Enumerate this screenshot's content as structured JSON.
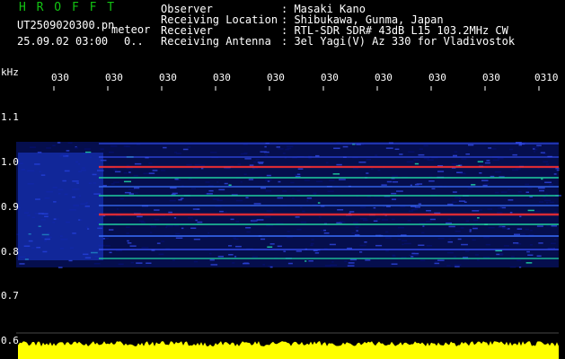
{
  "title": "H R O F F T",
  "file_name": "UT2509020300.pn",
  "meteor_label": "meteor",
  "date_time": "25.09.02 03:00",
  "count": "0..",
  "header": {
    "rows": [
      {
        "label": "Observer",
        "value": ": Masaki Kano"
      },
      {
        "label": "Receiving Location",
        "value": ": Shibukawa, Gunma, Japan"
      },
      {
        "label": "Receiver",
        "value": ": RTL-SDR SDR# 43dB L15 103.2MHz CW"
      },
      {
        "label": "Receiving Antenna",
        "value": ": 3el Yagi(V) Az 330 for Vladivostok"
      }
    ]
  },
  "axis": {
    "unit": "kHz",
    "y_labels": [
      "1.1",
      "1.0",
      "0.9",
      "0.8",
      "0.7",
      "0.6"
    ],
    "time_labels": [
      "030",
      "030",
      "030",
      "030",
      "030",
      "030",
      "030",
      "030",
      "030",
      "0310"
    ]
  },
  "colors": {
    "background": "#000000",
    "title": "#13c313",
    "text": "#ffffff",
    "spectrum_bar": "#ffff00",
    "echo_hot": "#ff3030",
    "echo_mid": "#20d0a0",
    "noise": "#0a1a8c"
  }
}
